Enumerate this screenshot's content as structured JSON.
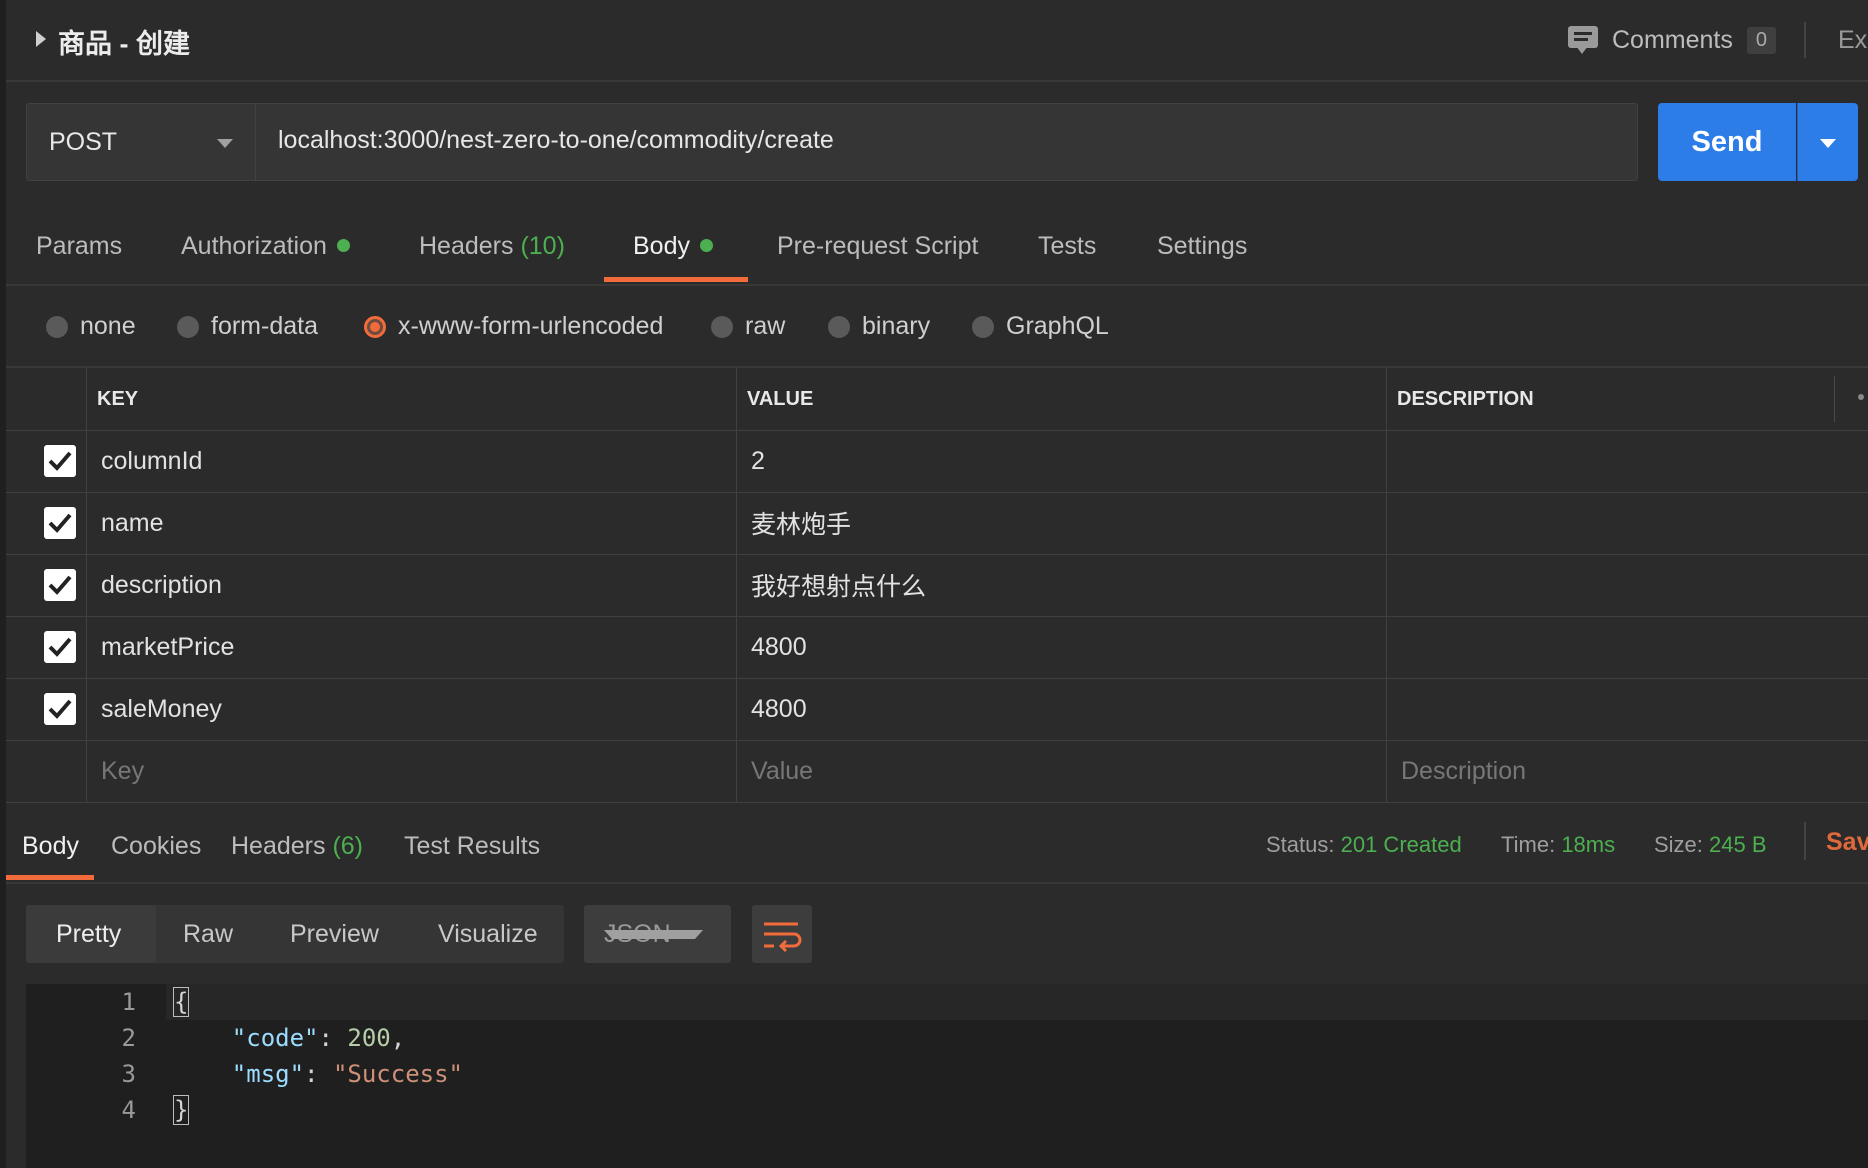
{
  "request": {
    "title": "商品 - 创建",
    "comments_label": "Comments",
    "comments_count": "0",
    "export_label": "Ex",
    "method": "POST",
    "url": "localhost:3000/nest-zero-to-one/commodity/create",
    "send_label": "Send"
  },
  "tabs": [
    {
      "label": "Params"
    },
    {
      "label": "Authorization"
    },
    {
      "label": "Headers",
      "count": "(10)"
    },
    {
      "label": "Body"
    },
    {
      "label": "Pre-request Script"
    },
    {
      "label": "Tests"
    },
    {
      "label": "Settings"
    }
  ],
  "active_tab": "Body",
  "body_types": [
    "none",
    "form-data",
    "x-www-form-urlencoded",
    "raw",
    "binary",
    "GraphQL"
  ],
  "selected_body_type": "x-www-form-urlencoded",
  "table": {
    "headers": [
      "KEY",
      "VALUE",
      "DESCRIPTION"
    ],
    "rows": [
      {
        "checked": true,
        "key": "columnId",
        "value": "2",
        "description": ""
      },
      {
        "checked": true,
        "key": "name",
        "value": "麦林炮手",
        "description": ""
      },
      {
        "checked": true,
        "key": "description",
        "value": "我好想射点什么",
        "description": ""
      },
      {
        "checked": true,
        "key": "marketPrice",
        "value": "4800",
        "description": ""
      },
      {
        "checked": true,
        "key": "saleMoney",
        "value": "4800",
        "description": ""
      }
    ],
    "placeholders": {
      "key": "Key",
      "value": "Value",
      "description": "Description"
    }
  },
  "response": {
    "tabs": [
      {
        "label": "Body"
      },
      {
        "label": "Cookies"
      },
      {
        "label": "Headers",
        "count": "(6)"
      },
      {
        "label": "Test Results"
      }
    ],
    "status_label": "Status:",
    "status_value": "201 Created",
    "time_label": "Time:",
    "time_value": "18ms",
    "size_label": "Size:",
    "size_value": "245 B",
    "save_label": "Save",
    "view_modes": [
      "Pretty",
      "Raw",
      "Preview",
      "Visualize"
    ],
    "format": "JSON",
    "line_numbers": [
      "1",
      "2",
      "3",
      "4"
    ],
    "json": {
      "code_key": "\"code\"",
      "code_value": "200",
      "msg_key": "\"msg\"",
      "msg_value": "\"Success\""
    }
  },
  "colors": {
    "accent": "#f26b3a",
    "send": "#2d7de8",
    "success": "#4caf50"
  }
}
